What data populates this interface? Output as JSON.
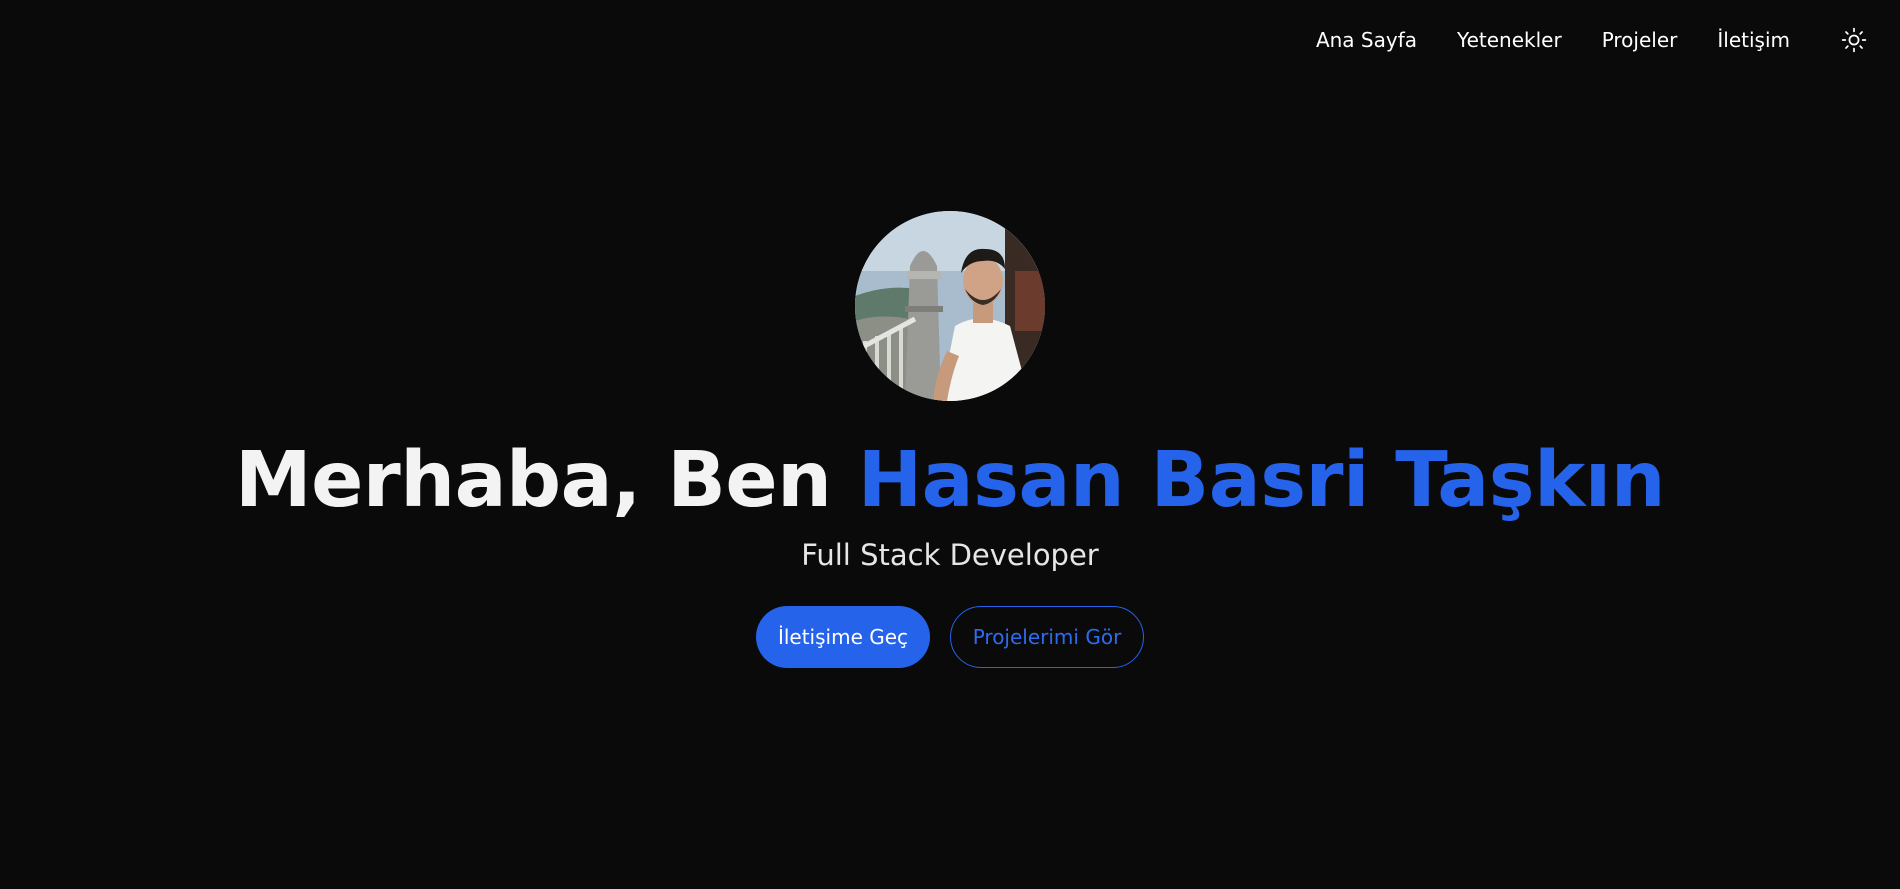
{
  "nav": {
    "items": [
      {
        "label": "Ana Sayfa"
      },
      {
        "label": "Yetenekler"
      },
      {
        "label": "Projeler"
      },
      {
        "label": "İletişim"
      }
    ],
    "theme_toggle_icon": "sun-icon"
  },
  "hero": {
    "greeting": "Merhaba, Ben ",
    "name": "Hasan Basri Taşkın",
    "subtitle": "Full Stack Developer",
    "primary_button": "İletişime Geç",
    "secondary_button": "Projelerimi Gör",
    "avatar_icon": "profile-photo"
  },
  "colors": {
    "background": "#0a0a0b",
    "accent": "#2563eb",
    "text": "#f2f2f2"
  }
}
